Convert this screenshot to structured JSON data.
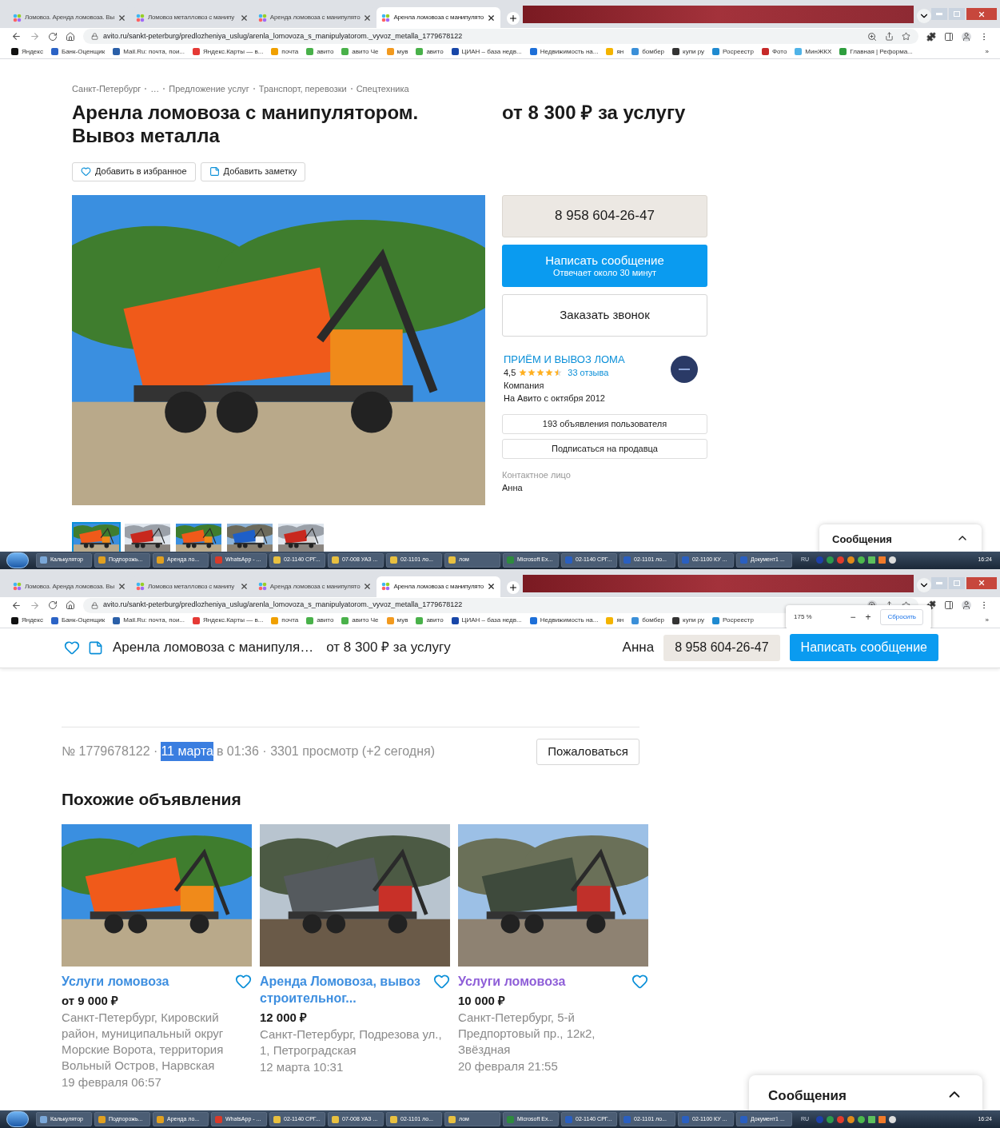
{
  "top_window": {
    "tabs": [
      {
        "label": "Ломовоз. Аренда ломовоза. Вы",
        "selected": false
      },
      {
        "label": "Ломовоз металловоз с манипу",
        "selected": false
      },
      {
        "label": "Аренда ломовоза с манипулято",
        "selected": false
      },
      {
        "label": "Аренла ломовоза с манипулято",
        "selected": true
      }
    ],
    "address": "avito.ru/sankt-peterburg/predlozheniya_uslug/arenla_lomovoza_s_manipulyatorom._vyvoz_metalla_1779678122",
    "bookmarks": [
      {
        "label": "Яндекс",
        "color": "#111111"
      },
      {
        "label": "Банк-Оценщик",
        "color": "#2b63c6"
      },
      {
        "label": "Mail.Ru: почта, пои...",
        "color": "#2a5fa8"
      },
      {
        "label": "Яндекс.Карты — в...",
        "color": "#e53935"
      },
      {
        "label": "почта",
        "color": "#f0a000"
      },
      {
        "label": "авито",
        "color": "#49b14a"
      },
      {
        "label": "авито Че",
        "color": "#49b14a"
      },
      {
        "label": "мув",
        "color": "#f29a1f"
      },
      {
        "label": "авито",
        "color": "#49b14a"
      },
      {
        "label": "ЦИАН – база недв...",
        "color": "#1846a8"
      },
      {
        "label": "Недвижимость на...",
        "color": "#1d6fd8"
      },
      {
        "label": "ян",
        "color": "#f4b400"
      },
      {
        "label": "бомбер",
        "color": "#3a8fd8"
      },
      {
        "label": "купи ру",
        "color": "#333333"
      },
      {
        "label": "Росреестр",
        "color": "#1f8ad0"
      },
      {
        "label": "Фото",
        "color": "#c62828"
      },
      {
        "label": "МинЖКХ",
        "color": "#4fb3e8"
      },
      {
        "label": "Главная | Реформа...",
        "color": "#2e9e3e"
      }
    ],
    "more_bookmarks": "»",
    "page": {
      "breadcrumbs": [
        "Санкт-Петербург",
        "…",
        "Предложение услуг",
        "Транспорт, перевозки",
        "Спецтехника"
      ],
      "title": "Аренла ломовоза с манипулятором. Вывоз металла",
      "price": "от 8 300 ₽ за услугу",
      "actions": [
        "Добавить в избранное",
        "Добавить заметку"
      ],
      "photo": {
        "kind": "picture"
      },
      "thumbnails": [
        {
          "selected": true
        },
        {
          "selected": false
        },
        {
          "selected": false
        },
        {
          "selected": false
        },
        {
          "selected": false
        }
      ],
      "phone": "8 958 604-26-47",
      "message_button": {
        "label": "Написать сообщение",
        "sublabel": "Отвечает около 30 минут"
      },
      "call_button": "Заказать звонок",
      "seller": {
        "name": "ПРИЁМ И ВЫВОЗ ЛОМА",
        "rating": "4,5",
        "stars": 4.5,
        "reviews": "33 отзыва",
        "type": "Компания",
        "since": "На Авито с октября 2012",
        "listings_button": "193 объявления пользователя",
        "subscribe_button": "Подписаться на продавца",
        "contact_label": "Контактное лицо",
        "contact_name": "Анна"
      },
      "chat": {
        "label": "Сообщения"
      }
    }
  },
  "taskbar_top": {
    "items": [
      {
        "label": "Калькулятор",
        "color": "#7aa7d8"
      },
      {
        "label": "Подпорожь...",
        "color": "#e0a020"
      },
      {
        "label": "Аренда ло...",
        "color": "#e0a020"
      },
      {
        "label": "WhatsApp - ...",
        "color": "#d83a2a"
      },
      {
        "label": "02-1140 СРГ...",
        "color": "#e8c040"
      },
      {
        "label": "07-008 УАЗ ...",
        "color": "#e8c040"
      },
      {
        "label": "02-1101 ло...",
        "color": "#e8c040"
      },
      {
        "label": "лом",
        "color": "#e8c040"
      },
      {
        "label": "Microsoft Ex...",
        "color": "#2e8b3e"
      },
      {
        "label": "02-1140 СРГ...",
        "color": "#2a5fc0"
      },
      {
        "label": "02-1101 ло...",
        "color": "#2a5fc0"
      },
      {
        "label": "02-1100 КУ ...",
        "color": "#2a5fc0"
      },
      {
        "label": "Документ1 ...",
        "color": "#2a5fc0"
      }
    ],
    "language": "RU",
    "time": "16:24"
  },
  "bottom_window": {
    "tabs": [
      {
        "label": "Ломовоз. Аренда ломовоза. Вы",
        "selected": false
      },
      {
        "label": "Ломовоз металловоз с манипу",
        "selected": false
      },
      {
        "label": "Аренда ломовоза с манипулято",
        "selected": false
      },
      {
        "label": "Аренла ломовоза с манипулято",
        "selected": true
      }
    ],
    "address": "avito.ru/sankt-peterburg/predlozheniya_uslug/arenla_lomovoza_s_manipulyatorom._vyvoz_metalla_1779678122",
    "bookmarks": [
      {
        "label": "Яндекс",
        "color": "#111111"
      },
      {
        "label": "Банк-Оценщик",
        "color": "#2b63c6"
      },
      {
        "label": "Mail.Ru: почта, пои...",
        "color": "#2a5fa8"
      },
      {
        "label": "Яндекс.Карты — в...",
        "color": "#e53935"
      },
      {
        "label": "почта",
        "color": "#f0a000"
      },
      {
        "label": "авито",
        "color": "#49b14a"
      },
      {
        "label": "авито Че",
        "color": "#49b14a"
      },
      {
        "label": "мув",
        "color": "#f29a1f"
      },
      {
        "label": "авито",
        "color": "#49b14a"
      },
      {
        "label": "ЦИАН – база недв...",
        "color": "#1846a8"
      },
      {
        "label": "Недвижимость на...",
        "color": "#1d6fd8"
      },
      {
        "label": "ян",
        "color": "#f4b400"
      },
      {
        "label": "бомбер",
        "color": "#3a8fd8"
      },
      {
        "label": "купи ру",
        "color": "#333333"
      },
      {
        "label": "Росреестр",
        "color": "#1f8ad0"
      }
    ],
    "more_bookmarks": "»",
    "zoom_popup": {
      "value": "175 %",
      "minus": "−",
      "plus": "+",
      "reset": "Сбросить"
    },
    "page": {
      "sticky_header": {
        "title": "Аренла ломовоза с манипуля…",
        "price": "от 8 300 ₽ за услугу",
        "contact": "Анна",
        "phone": "8 958 604-26-47",
        "message_button": "Написать сообщение"
      },
      "meta": [
        {
          "text": "№ 1779678122 ·",
          "highlighted": false
        },
        {
          "text": "11 марта",
          "highlighted": true
        },
        {
          "text": "в 01:36 · 3301 просмотр (+2 сегодня)",
          "highlighted": false
        }
      ],
      "report_button": "Пожаловаться",
      "similar_title": "Похожие объявления",
      "similar": [
        {
          "title": "Услуги ломовоза",
          "visited": false,
          "price": "от 9 000 ₽",
          "address": "Санкт-Петербург, Кировский район, муниципальный округ Морские Ворота, территория Вольный Остров, Нарвская",
          "date": "19 февраля 06:57"
        },
        {
          "title": "Аренда Ломовоза, вывоз строительног...",
          "visited": false,
          "price": "12 000 ₽",
          "address": "Санкт-Петербург, Подрезова ул., 1, Петроградская",
          "date": "12 марта 10:31"
        },
        {
          "title": "Услуги ломовоза",
          "visited": true,
          "price": "10 000 ₽",
          "address": "Санкт-Петербург, 5-й Предпортовый пр., 12к2, Звёздная",
          "date": "20 февраля 21:55"
        }
      ],
      "chat": {
        "label": "Сообщения"
      }
    }
  },
  "taskbar_bottom": {
    "items": [
      {
        "label": "Калькулятор",
        "color": "#7aa7d8"
      },
      {
        "label": "Подпорожь...",
        "color": "#e0a020"
      },
      {
        "label": "Аренда ло...",
        "color": "#e0a020"
      },
      {
        "label": "WhatsApp - ...",
        "color": "#d83a2a"
      },
      {
        "label": "02-1140 СРГ...",
        "color": "#e8c040"
      },
      {
        "label": "07-008 УАЗ ...",
        "color": "#e8c040"
      },
      {
        "label": "02-1101 ло...",
        "color": "#e8c040"
      },
      {
        "label": "лом",
        "color": "#e8c040"
      },
      {
        "label": "Microsoft Ex...",
        "color": "#2e8b3e"
      },
      {
        "label": "02-1140 СРГ...",
        "color": "#2a5fc0"
      },
      {
        "label": "02-1101 ло...",
        "color": "#2a5fc0"
      },
      {
        "label": "02-1100 КУ ...",
        "color": "#2a5fc0"
      },
      {
        "label": "Документ1 ...",
        "color": "#2a5fc0"
      }
    ],
    "language": "RU",
    "time": "16:24"
  }
}
